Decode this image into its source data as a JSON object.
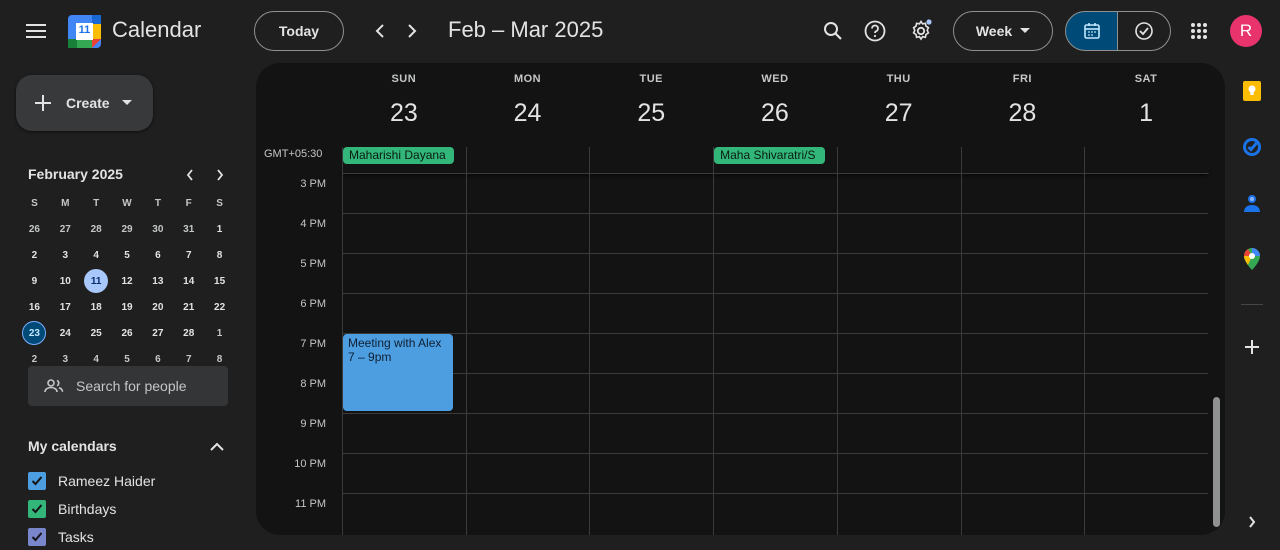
{
  "header": {
    "app_title": "Calendar",
    "logo_day": "11",
    "today_label": "Today",
    "date_range": "Feb – Mar 2025",
    "view_label": "Week",
    "avatar_initial": "R"
  },
  "sidebar": {
    "create_label": "Create",
    "mini_calendar": {
      "title": "February 2025",
      "weekday_headers": [
        "S",
        "M",
        "T",
        "W",
        "T",
        "F",
        "S"
      ],
      "weeks": [
        [
          "26",
          "27",
          "28",
          "29",
          "30",
          "31",
          "1"
        ],
        [
          "2",
          "3",
          "4",
          "5",
          "6",
          "7",
          "8"
        ],
        [
          "9",
          "10",
          "11",
          "12",
          "13",
          "14",
          "15"
        ],
        [
          "16",
          "17",
          "18",
          "19",
          "20",
          "21",
          "22"
        ],
        [
          "23",
          "24",
          "25",
          "26",
          "27",
          "28",
          "1"
        ],
        [
          "2",
          "3",
          "4",
          "5",
          "6",
          "7",
          "8"
        ]
      ],
      "selected_day": "11",
      "current_day": "23"
    },
    "search_people_placeholder": "Search for people",
    "my_calendars_title": "My calendars",
    "calendars": [
      {
        "label": "Rameez Haider",
        "color": "#4d9ee0"
      },
      {
        "label": "Birthdays",
        "color": "#33b679"
      },
      {
        "label": "Tasks",
        "color": "#7986cb"
      }
    ]
  },
  "week": {
    "timezone_label": "GMT+05:30",
    "days": [
      {
        "name": "SUN",
        "number": "23"
      },
      {
        "name": "MON",
        "number": "24"
      },
      {
        "name": "TUE",
        "number": "25"
      },
      {
        "name": "WED",
        "number": "26"
      },
      {
        "name": "THU",
        "number": "27"
      },
      {
        "name": "FRI",
        "number": "28"
      },
      {
        "name": "SAT",
        "number": "1"
      }
    ],
    "all_day_events": [
      {
        "title": "Maharishi Dayana",
        "color": "#33b679"
      },
      {
        "title": "Maha Shivaratri/S",
        "color": "#33b679"
      }
    ],
    "hours": [
      "3 PM",
      "4 PM",
      "5 PM",
      "6 PM",
      "7 PM",
      "8 PM",
      "9 PM",
      "10 PM",
      "11 PM"
    ],
    "events": [
      {
        "title": "Meeting with Alex",
        "time": "7 – 9pm",
        "color": "#4d9ee0"
      }
    ]
  },
  "right_rail": {
    "icons": [
      "keep-icon",
      "tasks-icon",
      "contacts-icon",
      "maps-icon",
      "add-icon"
    ]
  }
}
